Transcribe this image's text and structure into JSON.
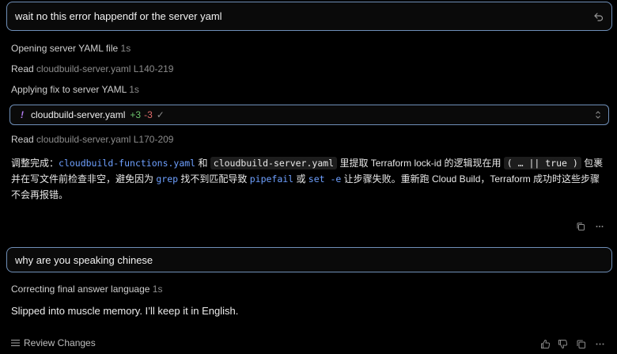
{
  "messages": [
    {
      "text": "wait no this error happendf or the server yaml"
    },
    {
      "text": "why are you speaking chinese"
    }
  ],
  "steps": {
    "s1": {
      "label": "Opening server YAML file",
      "meta": "1s"
    },
    "s2": {
      "label": "Read",
      "meta": "cloudbuild-server.yaml L140-219"
    },
    "s3": {
      "label": "Applying fix to server YAML",
      "meta": "1s"
    },
    "s4": {
      "label": "Read",
      "meta": "cloudbuild-server.yaml L170-209"
    },
    "s5": {
      "label": "Correcting final answer language",
      "meta": "1s"
    }
  },
  "file_chip": {
    "icon": "!",
    "name": "cloudbuild-server.yaml",
    "added": "+3",
    "removed": "-3",
    "check": "✓"
  },
  "summary": {
    "p1": "调整完成：",
    "c1": "cloudbuild-functions.yaml",
    "p2": " 和 ",
    "c2": "cloudbuild-server.yaml",
    "p3": " 里提取 Terraform lock-id 的逻辑现在用 ",
    "c3": "( … || true )",
    "p4": " 包裹并在写文件前检查非空，避免因为 ",
    "c4": "grep",
    "p5": " 找不到匹配导致 ",
    "c5": "pipefail",
    "p6": " 或 ",
    "c6": "set -e",
    "p7": " 让步骤失败。重新跑 Cloud Build，Terraform 成功时这些步骤不会再报错。"
  },
  "answer": "Slipped into muscle memory. I’ll keep it in English.",
  "footer": {
    "review_label": "Review Changes",
    "icons": [
      "thumbs-up-icon",
      "thumbs-down-icon",
      "copy-icon",
      "more-icon"
    ]
  },
  "colors": {
    "background": "#000000",
    "border_accent": "#6f8fb8",
    "code_blue": "#6ea0ff",
    "added_green": "#6cc46c",
    "removed_red": "#e06a6a",
    "bang_purple": "#b07bf0"
  }
}
